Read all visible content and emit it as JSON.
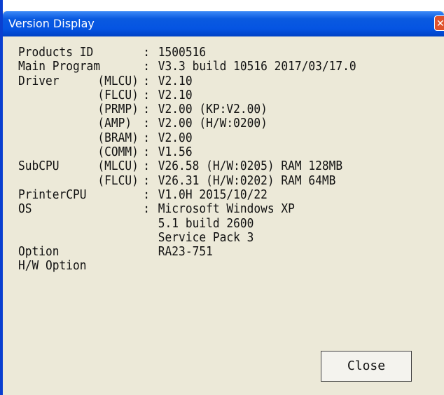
{
  "window": {
    "title": "Version Display",
    "close_glyph": "✕",
    "close_button_label": "Close"
  },
  "rows": [
    {
      "label": "Products ID",
      "sub": "",
      "value": "1500516"
    },
    {
      "label": "Main Program",
      "sub": "",
      "value": "V3.3 build 10516 2017/03/17.0"
    },
    {
      "label": "Driver",
      "sub": "(MLCU)",
      "value": "V2.10"
    },
    {
      "label": "",
      "sub": "(FLCU)",
      "value": "V2.10"
    },
    {
      "label": "",
      "sub": "(PRMP)",
      "value": "V2.00 (KP:V2.00)"
    },
    {
      "label": "",
      "sub": "(AMP)",
      "value": "V2.00 (H/W:0200)"
    },
    {
      "label": "",
      "sub": "(BRAM)",
      "value": "V2.00"
    },
    {
      "label": "",
      "sub": "(COMM)",
      "value": "V1.56"
    },
    {
      "label": "SubCPU",
      "sub": "(MLCU)",
      "value": "V26.58 (H/W:0205) RAM 128MB"
    },
    {
      "label": "",
      "sub": "(FLCU)",
      "value": "V26.31 (H/W:0202) RAM 64MB"
    },
    {
      "label": "PrinterCPU",
      "sub": "",
      "value": "V1.0H 2015/10/22"
    },
    {
      "label": "OS",
      "sub": "",
      "value": "Microsoft Windows XP"
    },
    {
      "label": "",
      "sub": "",
      "value": "5.1 build 2600",
      "continuation": true
    },
    {
      "label": "",
      "sub": "",
      "value": "Service Pack 3",
      "continuation": true
    },
    {
      "label": "Option",
      "sub": "",
      "value": "RA23-751",
      "no_colon": true
    },
    {
      "label": "H/W Option",
      "sub": "",
      "value": "",
      "no_colon": true
    }
  ],
  "colors": {
    "title_bar": "#0554e2",
    "dialog_bg": "#ece9d8",
    "close_x_bg": "#e0522c"
  }
}
